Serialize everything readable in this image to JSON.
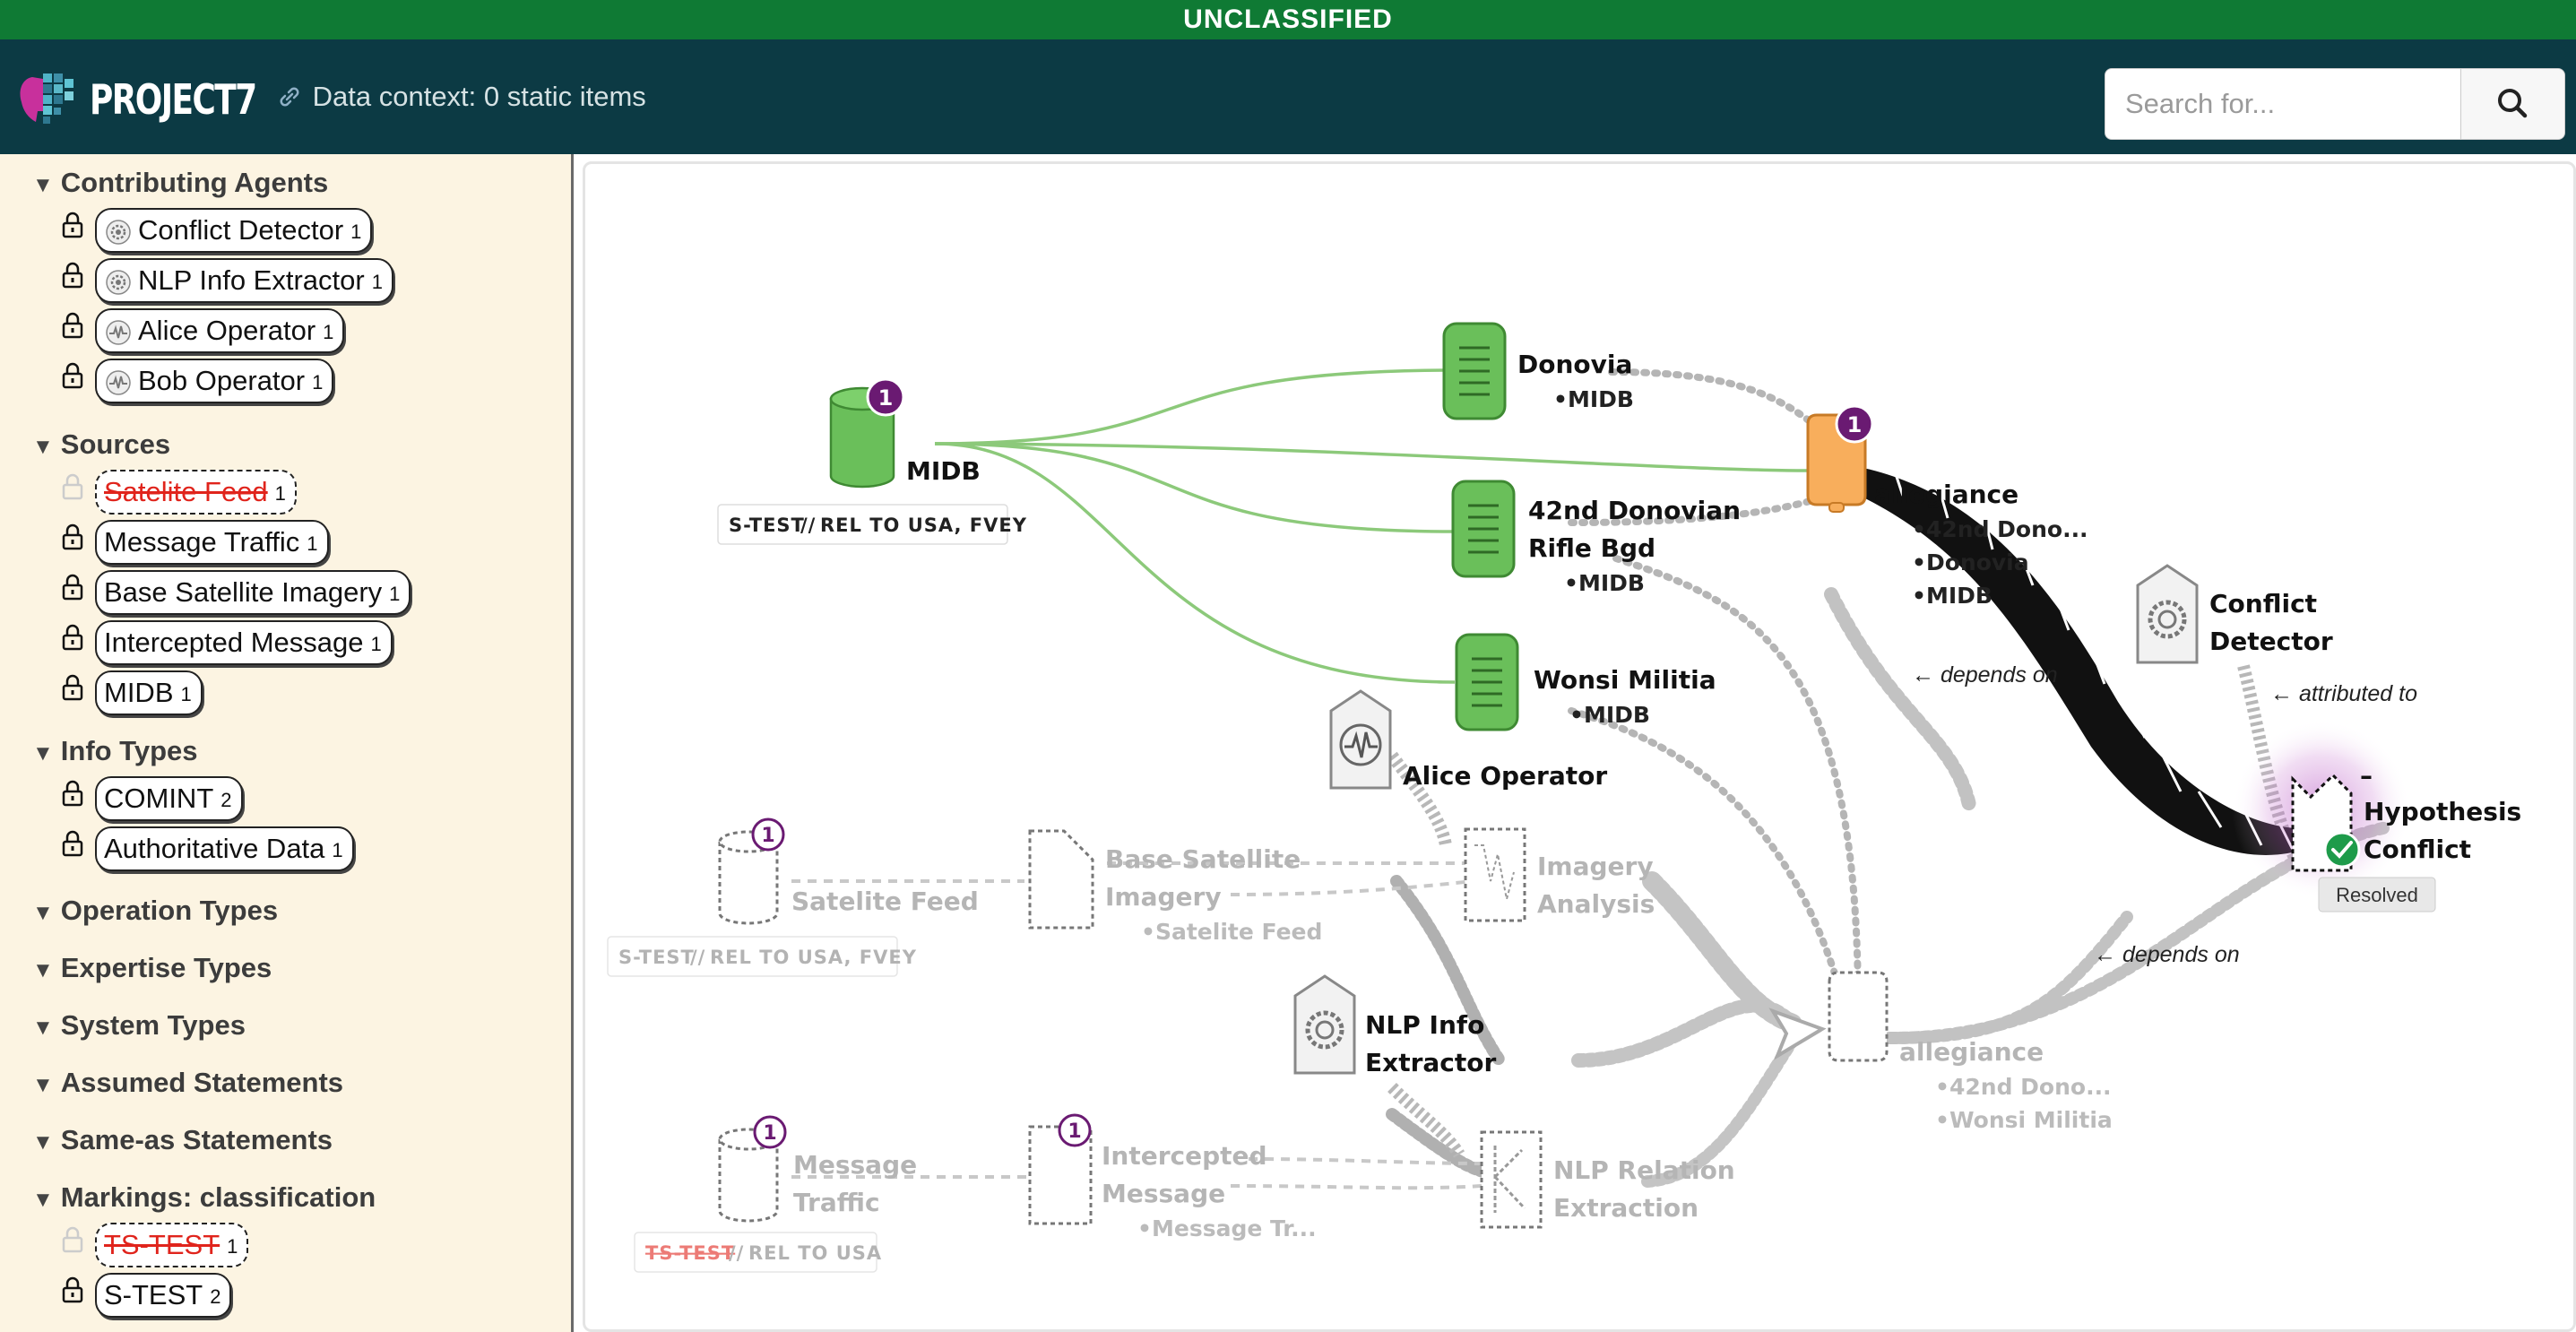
{
  "banner": {
    "text": "UNCLASSIFIED"
  },
  "header": {
    "logo_text": "PROJECT7",
    "context_text": "Data context: 0 static items",
    "search_placeholder": "Search for..."
  },
  "sidebar": {
    "sections": [
      {
        "title": "Contributing Agents",
        "items": [
          {
            "label": "Conflict Detector",
            "count": "1",
            "icon": "gear-icon"
          },
          {
            "label": "NLP Info Extractor",
            "count": "1",
            "icon": "gear-icon"
          },
          {
            "label": "Alice Operator",
            "count": "1",
            "icon": "pulse-icon"
          },
          {
            "label": "Bob Operator",
            "count": "1",
            "icon": "pulse-icon"
          }
        ]
      },
      {
        "title": "Sources",
        "items": [
          {
            "label": "Satelite Feed",
            "count": "1",
            "disabled": true
          },
          {
            "label": "Message Traffic",
            "count": "1"
          },
          {
            "label": "Base Satellite Imagery",
            "count": "1"
          },
          {
            "label": "Intercepted Message",
            "count": "1"
          },
          {
            "label": "MIDB",
            "count": "1"
          }
        ]
      },
      {
        "title": "Info Types",
        "items": [
          {
            "label": "COMINT",
            "count": "2"
          },
          {
            "label": "Authoritative Data",
            "count": "1"
          }
        ]
      },
      {
        "title": "Operation Types"
      },
      {
        "title": "Expertise Types"
      },
      {
        "title": "System Types"
      },
      {
        "title": "Assumed Statements"
      },
      {
        "title": "Same-as Statements"
      },
      {
        "title": "Markings: classification",
        "items": [
          {
            "label": "TS-TEST",
            "count": "1",
            "disabled": true
          },
          {
            "label": "S-TEST",
            "count": "2"
          }
        ]
      }
    ]
  },
  "graph": {
    "midb": {
      "label": "MIDB",
      "badge": "1",
      "marking_a": "S-TEST",
      "marking_b": "REL TO USA, FVEY"
    },
    "donovia": {
      "label": "Donovia",
      "sources": [
        "•MIDB"
      ]
    },
    "rifle": {
      "label_1": "42nd Donovian",
      "label_2": "Rifle Bgd",
      "sources": [
        "•MIDB"
      ]
    },
    "wonsi": {
      "label": "Wonsi Militia",
      "sources": [
        "•MIDB"
      ]
    },
    "allegiance_main": {
      "label": "allegiance",
      "badge": "1",
      "sources": [
        "•42nd Dono...",
        "•Donovia",
        "•MIDB"
      ]
    },
    "conflict_detector": {
      "label_1": "Conflict",
      "label_2": "Detector"
    },
    "alice": {
      "label": "Alice Operator"
    },
    "nlp_extractor": {
      "label_1": "NLP Info",
      "label_2": "Extractor"
    },
    "satelite_feed": {
      "label": "Satelite Feed",
      "badge": "1",
      "marking_a": "S-TEST",
      "marking_b": "REL TO USA, FVEY"
    },
    "base_imagery": {
      "label_1": "Base Satellite",
      "label_2": "Imagery",
      "sources": [
        "•Satelite Feed"
      ]
    },
    "imagery_analysis": {
      "label_1": "Imagery",
      "label_2": "Analysis"
    },
    "message_traffic": {
      "label_1": "Message",
      "label_2": "Traffic",
      "badge": "1",
      "marking_a": "TS-TEST",
      "marking_b": "REL TO USA"
    },
    "intercepted": {
      "label_1": "Intercepted",
      "label_2": "Message",
      "badge": "1",
      "sources": [
        "•Message Tr..."
      ]
    },
    "nlp_relation": {
      "label_1": "NLP Relation",
      "label_2": "Extraction"
    },
    "allegiance_dim": {
      "label": "allegiance",
      "sources": [
        "•42nd Dono...",
        "•Wonsi Militia"
      ]
    },
    "hypothesis": {
      "label_1": "Hypothesis",
      "label_2": "Conflict",
      "dash": "–",
      "status": "Resolved"
    },
    "edge_labels": {
      "depends_on_1": "← depends on",
      "attributed_to": "← attributed to",
      "depends_on_2": "← depends on"
    }
  },
  "colors": {
    "banner": "#0f7a34",
    "header": "#0c3a44",
    "sidebar": "#fcf4e2",
    "green_node": "#6abf5a",
    "orange_node": "#f8ae5c",
    "badge": "#6a1a72",
    "resolved": "#1e9b4a"
  }
}
